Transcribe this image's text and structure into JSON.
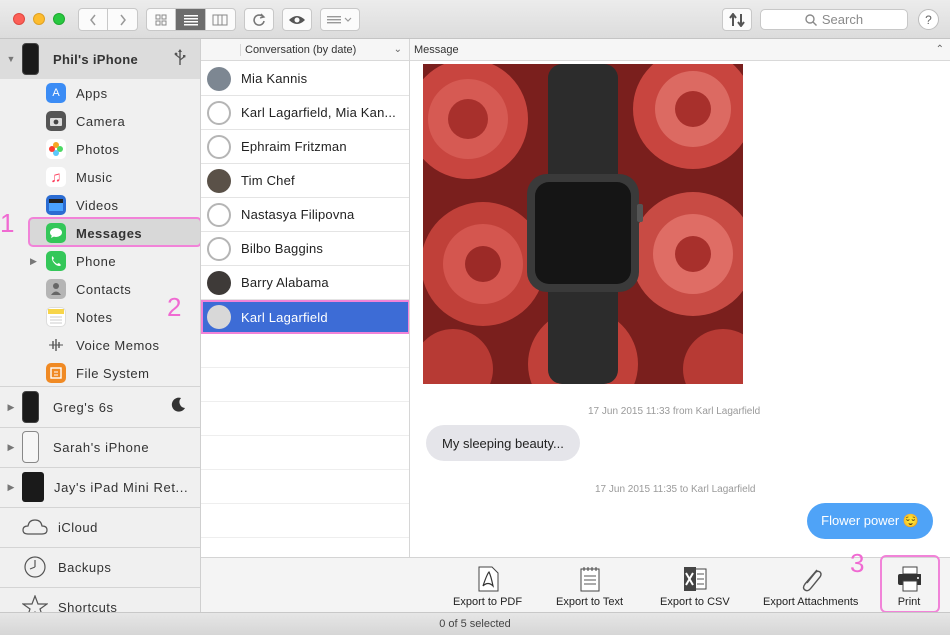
{
  "toolbar": {
    "search_placeholder": "Search",
    "help_label": "?"
  },
  "sidebar": {
    "device": {
      "name": "Phil's iPhone",
      "extra_icon": "usb-icon"
    },
    "items": [
      {
        "label": "Apps",
        "icon": "app-store-icon",
        "color": "#3b8cf5"
      },
      {
        "label": "Camera",
        "icon": "camera-icon",
        "color": "#555555"
      },
      {
        "label": "Photos",
        "icon": "photos-icon",
        "color": "#f6a623"
      },
      {
        "label": "Music",
        "icon": "music-icon",
        "color": "#fc3c5a"
      },
      {
        "label": "Videos",
        "icon": "videos-icon",
        "color": "#2b6cd2"
      },
      {
        "label": "Messages",
        "icon": "messages-icon",
        "color": "#34c759"
      },
      {
        "label": "Phone",
        "icon": "phone-icon",
        "color": "#34c759"
      },
      {
        "label": "Contacts",
        "icon": "contacts-icon",
        "color": "#8a8a8a"
      },
      {
        "label": "Notes",
        "icon": "notes-icon",
        "color": "#f7d54a"
      },
      {
        "label": "Voice Memos",
        "icon": "voice-memos-icon",
        "color": "#555555"
      },
      {
        "label": "File System",
        "icon": "file-system-icon",
        "color": "#f08a24"
      }
    ],
    "other_devices": [
      {
        "name": "Greg's 6s",
        "extra_icon": "moon-icon"
      },
      {
        "name": "Sarah's iPhone"
      },
      {
        "name": "Jay's iPad Mini Ret..."
      }
    ],
    "bottom": [
      {
        "label": "iCloud",
        "icon": "cloud-icon"
      },
      {
        "label": "Backups",
        "icon": "clock-icon"
      },
      {
        "label": "Shortcuts",
        "icon": "star-icon"
      }
    ]
  },
  "conversations": {
    "header": "Conversation (by date)",
    "rows": [
      {
        "name": "Mia Kannis"
      },
      {
        "name": "Karl Lagarfield, Mia Kan..."
      },
      {
        "name": "Ephraim Fritzman"
      },
      {
        "name": "Tim Chef"
      },
      {
        "name": "Nastasya Filipovna"
      },
      {
        "name": "Bilbo Baggins"
      },
      {
        "name": "Barry Alabama"
      },
      {
        "name": "Karl Lagarfield"
      }
    ]
  },
  "message_pane": {
    "header": "Message",
    "meta1": "17 Jun 2015 11:33 from Karl Lagarfield",
    "bubble_in": "My sleeping beauty...",
    "meta2": "17 Jun 2015 11:35 to Karl Lagarfield",
    "bubble_out": "Flower power 😌"
  },
  "actions": [
    {
      "label": "Export to PDF",
      "icon": "pdf-icon"
    },
    {
      "label": "Export to Text",
      "icon": "text-file-icon"
    },
    {
      "label": "Export to CSV",
      "icon": "excel-icon"
    },
    {
      "label": "Export Attachments",
      "icon": "paperclip-icon"
    },
    {
      "label": "Print",
      "icon": "printer-icon"
    }
  ],
  "status": {
    "text": "0 of 5 selected"
  },
  "steps": {
    "one": "1",
    "two": "2",
    "three": "3"
  },
  "colors": {
    "accent": "#3d6cd6",
    "highlight": "#f183d8",
    "bubble_out": "#4fa3f7"
  }
}
